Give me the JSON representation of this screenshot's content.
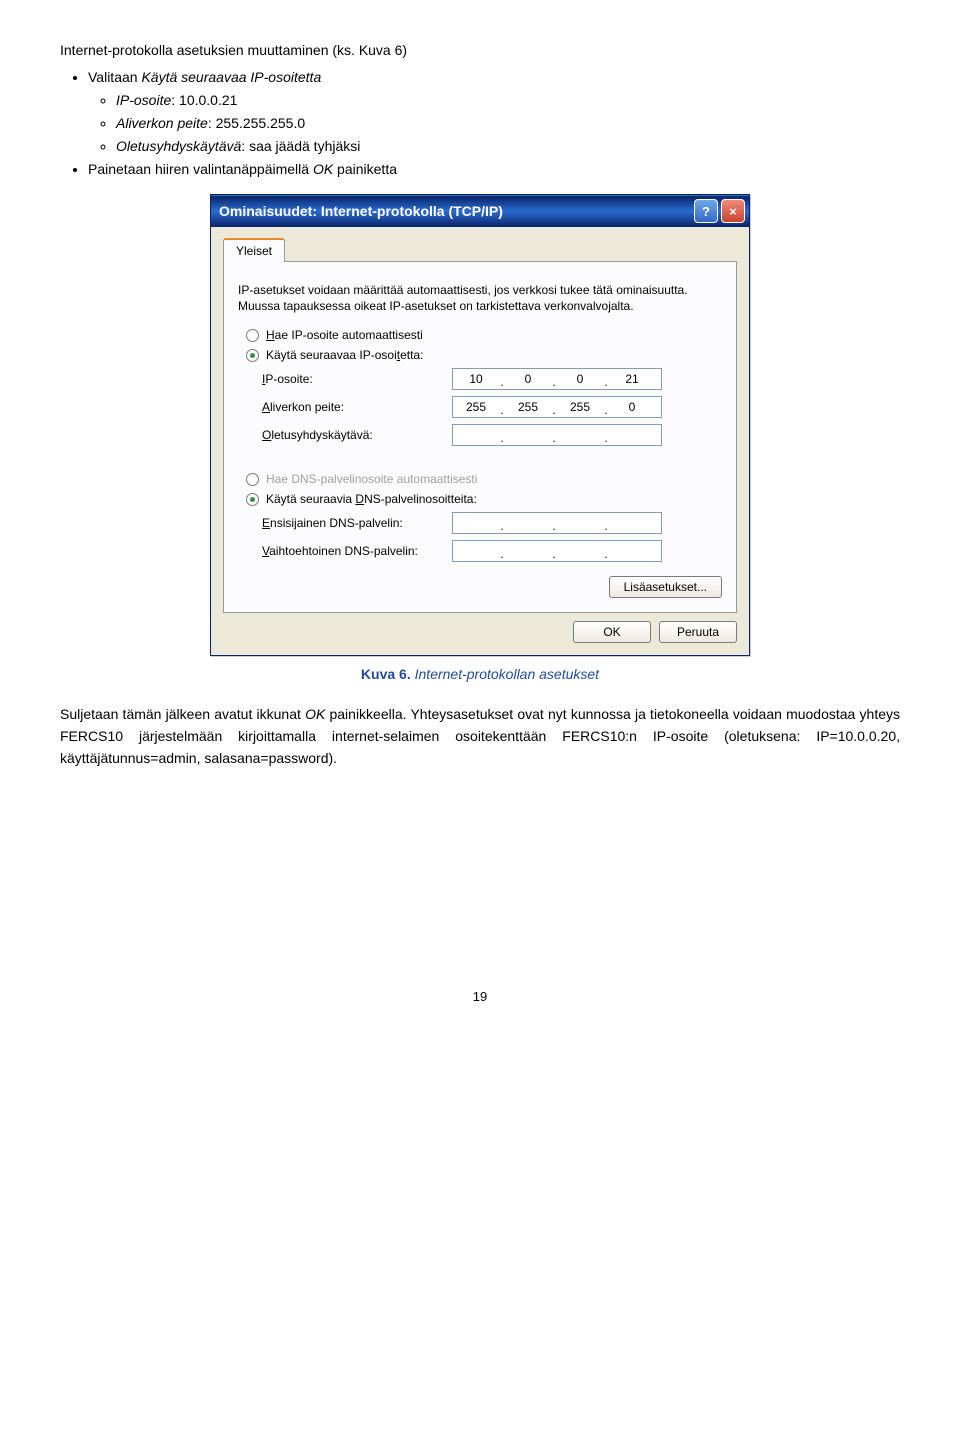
{
  "intro_line": "Internet-protokolla asetuksien muuttaminen (ks. Kuva 6)",
  "bullets": {
    "b1_pre": "Valitaan ",
    "b1_it": "Käytä seuraavaa IP-osoitetta",
    "sub1_pre": "IP-osoite",
    "sub1_val": ": 10.0.0.21",
    "sub2_pre": "Aliverkon peite",
    "sub2_val": ": 255.255.255.0",
    "sub3_pre": "Oletusyhdyskäytävä",
    "sub3_val": ": saa jäädä tyhjäksi",
    "b2_pre": "Painetaan hiiren valintanäppäimellä ",
    "b2_it": "OK",
    "b2_post": " painiketta"
  },
  "dialog": {
    "title": "Ominaisuudet: Internet-protokolla (TCP/IP)",
    "tab": "Yleiset",
    "desc": "IP-asetukset voidaan määrittää automaattisesti, jos verkkosi tukee tätä ominaisuutta. Muussa tapauksessa oikeat IP-asetukset on tarkistettava verkonvalvojalta.",
    "r1": "Hae IP-osoite automaattisesti",
    "r1_u": "H",
    "r2_pre": "Käytä seuraavaa IP-osoi",
    "r2_u": "t",
    "r2_post": "etta:",
    "f1": "IP-osoite:",
    "f1_u": "I",
    "f1_rest": "P-osoite:",
    "f1_oct": [
      "10",
      "0",
      "0",
      "21"
    ],
    "f2_u": "A",
    "f2_rest": "liverkon peite:",
    "f2_oct": [
      "255",
      "255",
      "255",
      "0"
    ],
    "f3_u": "O",
    "f3_rest": "letusyhdyskäytävä:",
    "f3_oct": [
      "",
      "",
      "",
      ""
    ],
    "r3": "Hae DNS-palvelinosoite automaattisesti",
    "r4_pre": "Käytä seuraavia ",
    "r4_u": "D",
    "r4_post": "NS-palvelinosoitteita:",
    "f4_u": "E",
    "f4_rest": "nsisijainen DNS-palvelin:",
    "f5_u": "V",
    "f5_rest": "aihtoehtoinen DNS-palvelin:",
    "adv_btn": "Lisäasetukset...",
    "ok": "OK",
    "cancel": "Peruuta"
  },
  "caption_bold": "Kuva 6.",
  "caption_it": " Internet-protokollan asetukset",
  "para2_pre": "Suljetaan tämän jälkeen avatut ikkunat ",
  "para2_it": "OK",
  "para2_post": " painikkeella. Yhteysasetukset ovat nyt kunnossa ja tietokoneella voidaan muodostaa yhteys FERCS10 järjestelmään kirjoittamalla internet-selaimen osoitekenttään FERCS10:n IP-osoite (oletuksena: IP=10.0.0.20, käyttäjätunnus=admin, salasana=password).",
  "page_num": "19"
}
